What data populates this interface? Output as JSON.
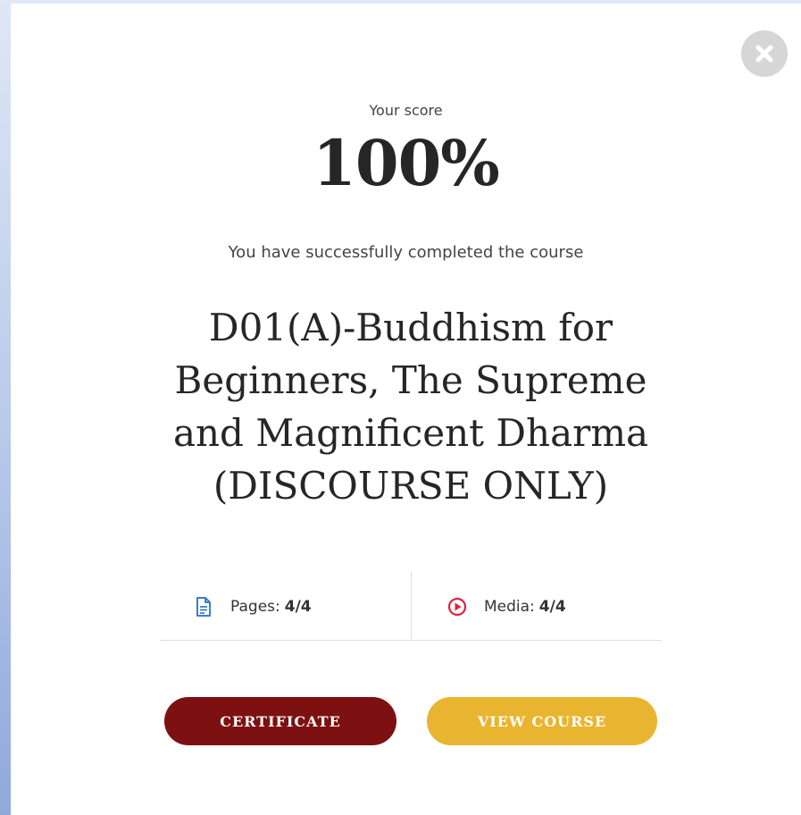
{
  "modal": {
    "close_icon": "close-x-icon",
    "score_label": "Your score",
    "score_value": "100%",
    "completion_message": "You have successfully completed the course",
    "course_title": "D01(A)-Buddhism for Beginners, The Supreme and Magnificent Dharma (DISCOURSE ONLY)",
    "stats": {
      "pages": {
        "icon": "document-icon",
        "label": "Pages:",
        "value": "4/4",
        "icon_color": "#3a7bd5"
      },
      "media": {
        "icon": "play-circle-icon",
        "label": "Media:",
        "value": "4/4",
        "icon_color": "#e0213b"
      }
    },
    "buttons": {
      "certificate": {
        "label": "CERTIFICATE",
        "color": "#7d1111"
      },
      "view_course": {
        "label": "VIEW COURSE",
        "color": "#e9b531"
      }
    }
  }
}
